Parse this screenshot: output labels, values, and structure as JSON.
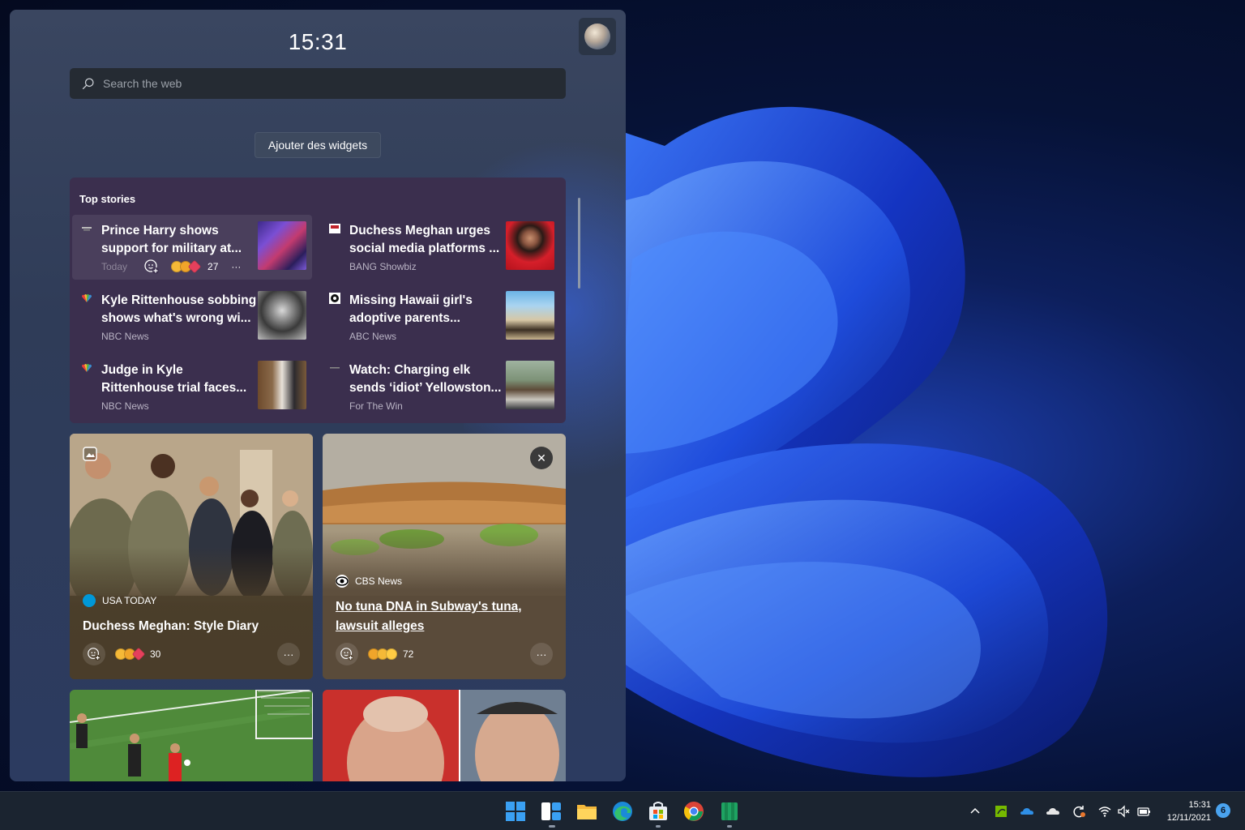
{
  "panel": {
    "clock": "15:31",
    "search_placeholder": "Search the web",
    "add_widgets_label": "Ajouter des widgets"
  },
  "top_stories": {
    "title": "Top stories",
    "items": [
      {
        "headline": "Prince Harry shows support for military at...",
        "source": "Today",
        "reaction_count": "27",
        "more": "···"
      },
      {
        "headline": "Duchess Meghan urges social media platforms ...",
        "source": "BANG Showbiz"
      },
      {
        "headline": "Kyle Rittenhouse sobbing shows what's wrong wi...",
        "source": "NBC News"
      },
      {
        "headline": "Missing Hawaii girl's adoptive parents...",
        "source": "ABC News"
      },
      {
        "headline": "Judge in Kyle Rittenhouse trial faces...",
        "source": "NBC News"
      },
      {
        "headline": "Watch: Charging elk sends ‘idiot’ Yellowston...",
        "source": "For The Win"
      }
    ]
  },
  "cards": [
    {
      "source": "USA TODAY",
      "title": "Duchess Meghan: Style Diary",
      "reaction_count": "30",
      "more": "···"
    },
    {
      "source": "CBS News",
      "title": "No tuna DNA in Subway's tuna, lawsuit alleges",
      "reaction_count": "72",
      "more": "···",
      "close": "✕"
    }
  ],
  "taskbar": {
    "time": "15:31",
    "date": "12/11/2021",
    "notifications": "6",
    "apps": [
      "start-icon",
      "widgets-icon",
      "file-explorer-icon",
      "edge-icon",
      "store-icon",
      "chrome-icon",
      "app-icon"
    ]
  },
  "colors": {
    "accent": "#4aa3ef",
    "top_stories_bg": "#3b2f4e",
    "panel_bg": "#2f3c58"
  }
}
